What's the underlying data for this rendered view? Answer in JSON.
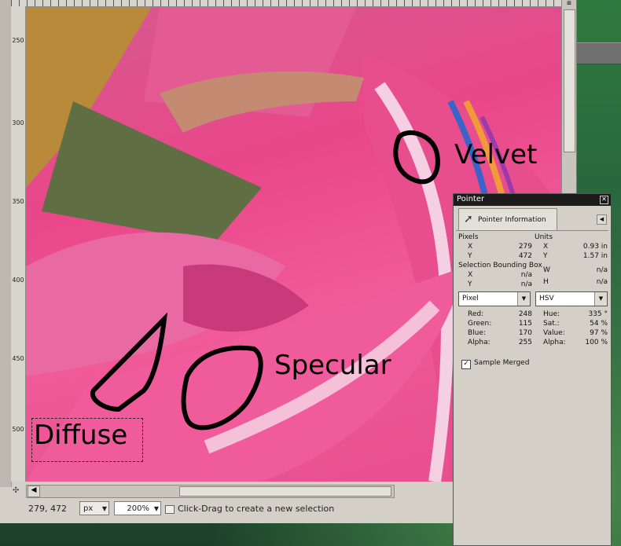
{
  "canvas_labels": {
    "velvet": "Velvet",
    "specular": "Specular",
    "diffuse": "Diffuse"
  },
  "ruler_left": {
    "ticks": [
      "250",
      "300",
      "350",
      "400",
      "450",
      "500"
    ]
  },
  "statusbar": {
    "coords": "279, 472",
    "unit": "px",
    "zoom": "200%",
    "message": "Click-Drag to create a new selection"
  },
  "pointer_dialog": {
    "title": "Pointer",
    "tab_label": "Pointer Information",
    "pixels_header": "Pixels",
    "units_header": "Units",
    "pixel_x_label": "X",
    "pixel_x": "279",
    "pixel_y_label": "Y",
    "pixel_y": "472",
    "unit_x_label": "X",
    "unit_x": "0.93 in",
    "unit_y_label": "Y",
    "unit_y": "1.57 in",
    "selection_header": "Selection Bounding Box",
    "sel_x_label": "X",
    "sel_x": "n/a",
    "sel_y_label": "Y",
    "sel_y": "n/a",
    "sel_w_label": "W",
    "sel_w": "n/a",
    "sel_h_label": "H",
    "sel_h": "n/a",
    "left_mode": "Pixel",
    "right_mode": "HSV",
    "left_values": [
      {
        "label": "Red:",
        "value": "248"
      },
      {
        "label": "Green:",
        "value": "115"
      },
      {
        "label": "Blue:",
        "value": "170"
      },
      {
        "label": "Alpha:",
        "value": "255"
      }
    ],
    "right_values": [
      {
        "label": "Hue:",
        "value": "335 °"
      },
      {
        "label": "Sat.:",
        "value": "54 %"
      },
      {
        "label": "Value:",
        "value": "97 %"
      },
      {
        "label": "Alpha:",
        "value": "100 %"
      }
    ],
    "sample_merged_label": "Sample Merged",
    "sample_merged_checked": "✓"
  }
}
